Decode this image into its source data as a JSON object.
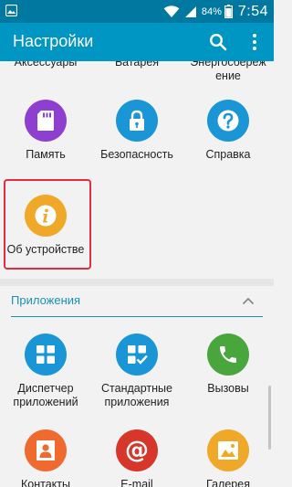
{
  "status_bar": {
    "battery_percent": "84%",
    "time": "7:54"
  },
  "app_bar": {
    "title": "Настройки"
  },
  "cut_row": {
    "labels": [
      "Аксессуары",
      "Батарея",
      "Энергосбереж",
      "ение"
    ]
  },
  "tiles_system": [
    {
      "label": "Память",
      "color": "#8e3fcf"
    },
    {
      "label": "Безопасность",
      "color": "#1a96d6"
    },
    {
      "label": "Справка",
      "color": "#1a96d6"
    },
    {
      "label": "Об устройстве",
      "color": "#f0a829"
    }
  ],
  "section": {
    "title": "Приложения"
  },
  "tiles_apps": [
    {
      "label_line1": "Диспетчер",
      "label_line2": "приложений",
      "color": "#1a96d6"
    },
    {
      "label_line1": "Стандартные",
      "label_line2": "приложения",
      "color": "#1a96d6"
    },
    {
      "label_line1": "Вызовы",
      "label_line2": "",
      "color": "#48a63d"
    },
    {
      "label_line1": "Контакты",
      "label_line2": "",
      "color": "#ef6a2f"
    },
    {
      "label_line1": "E-mail",
      "label_line2": "",
      "color": "#d6372a"
    },
    {
      "label_line1": "Галерея",
      "label_line2": "",
      "color": "#f0a829"
    }
  ],
  "icons": {
    "status_left": "gallery-notification-icon",
    "wifi": "wifi-icon",
    "signal": "signal-icon",
    "battery": "battery-icon",
    "search": "search-icon",
    "more": "more-vert-icon",
    "memory": "sd-card-icon",
    "security": "lock-icon",
    "help": "help-icon",
    "about": "info-icon",
    "app_manager": "app-grid-icon",
    "default_apps": "default-apps-icon",
    "calls": "phone-icon",
    "contacts": "contact-icon",
    "email": "at-icon",
    "gallery": "gallery-icon",
    "collapse": "chevron-up-icon"
  }
}
